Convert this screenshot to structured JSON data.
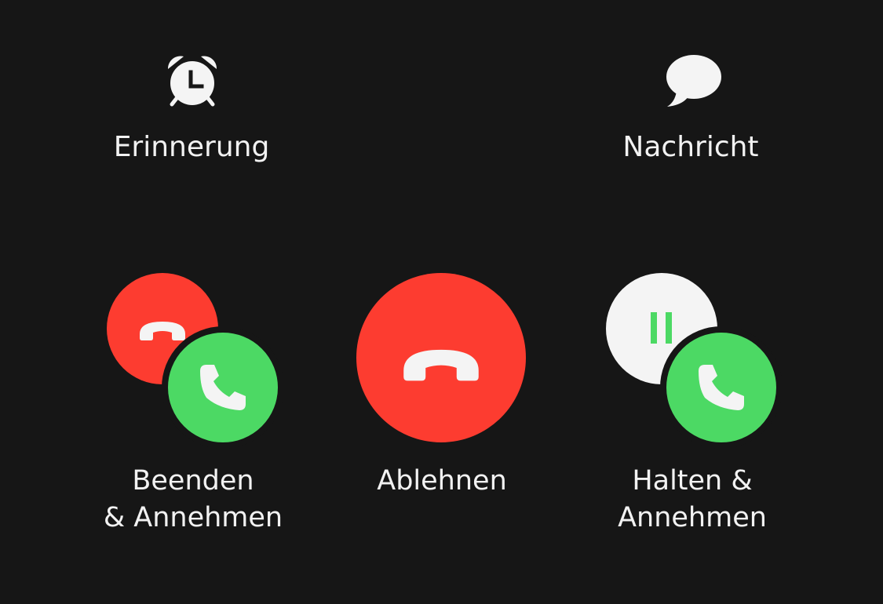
{
  "top_actions": {
    "reminder": {
      "label": "Erinnerung",
      "icon": "alarm-clock-icon"
    },
    "message": {
      "label": "Nachricht",
      "icon": "speech-bubble-icon"
    }
  },
  "call_actions": {
    "end_and_accept": {
      "label_line1": "Beenden",
      "label_line2": "& Annehmen",
      "icons": [
        "end-call-icon",
        "accept-call-icon"
      ]
    },
    "decline": {
      "label": "Ablehnen",
      "icon": "end-call-icon"
    },
    "hold_and_accept": {
      "label_line1": "Halten &",
      "label_line2": "Annehmen",
      "icons": [
        "pause-icon",
        "accept-call-icon"
      ]
    }
  },
  "colors": {
    "background": "#161616",
    "red": "#fd3c30",
    "green": "#4cd964",
    "white": "#f4f4f4",
    "text": "#f2f2f2"
  }
}
